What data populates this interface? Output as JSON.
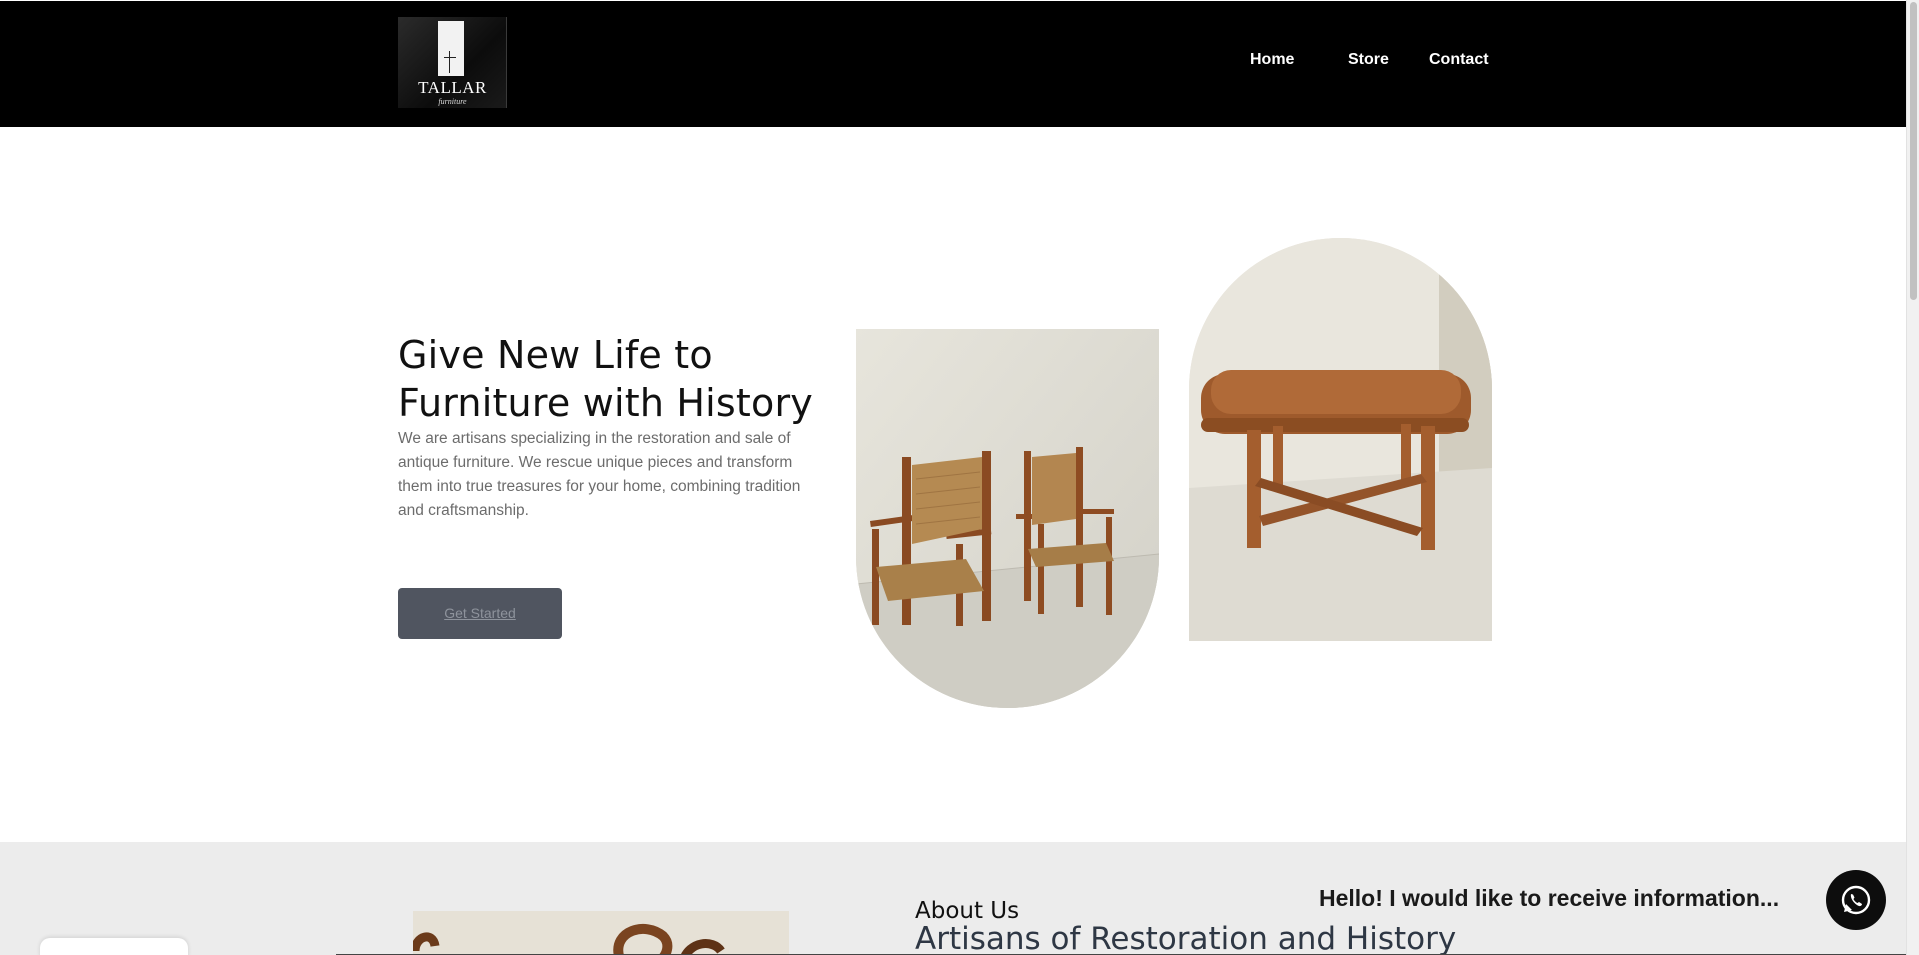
{
  "header": {
    "logo": {
      "brand": "TALLAR",
      "sub": "furniture"
    },
    "nav": [
      {
        "label": "Home"
      },
      {
        "label": "Store"
      },
      {
        "label": "Contact"
      }
    ]
  },
  "hero": {
    "title": "Give New Life to Furniture with History",
    "text": "We are artisans specializing in the restoration and sale of antique furniture. We rescue unique pieces and transform them into true treasures for your home, combining tradition and craftsmanship.",
    "cta_label": "Get Started"
  },
  "about": {
    "label": "About Us",
    "title": "Artisans of Restoration and History"
  },
  "whatsapp": {
    "message": "Hello! I would like to receive information...",
    "icon": "whatsapp-icon"
  },
  "colors": {
    "header_bg": "#000000",
    "about_bg": "#ececec",
    "cta_bg": "#505560",
    "text_muted": "#6c6c6c",
    "wa_button": "#0d0d0d"
  }
}
